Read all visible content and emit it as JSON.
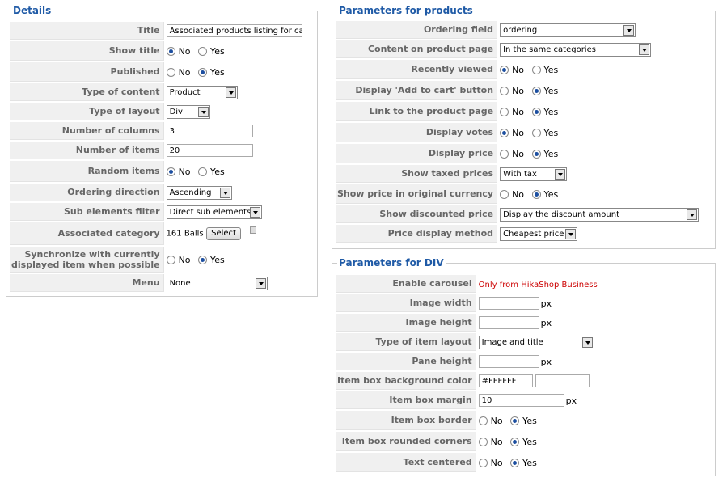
{
  "details": {
    "legend": "Details",
    "title": {
      "label": "Title",
      "value": "Associated products listing for categ"
    },
    "show_title": {
      "label": "Show title",
      "no": "No",
      "yes": "Yes"
    },
    "published": {
      "label": "Published",
      "no": "No",
      "yes": "Yes"
    },
    "type_of_content": {
      "label": "Type of content",
      "value": "Product"
    },
    "type_of_layout": {
      "label": "Type of layout",
      "value": "Div"
    },
    "number_of_columns": {
      "label": "Number of columns",
      "value": "3"
    },
    "number_of_items": {
      "label": "Number of items",
      "value": "20"
    },
    "random_items": {
      "label": "Random items",
      "no": "No",
      "yes": "Yes"
    },
    "ordering_direction": {
      "label": "Ordering direction",
      "value": "Ascending"
    },
    "sub_elements_filter": {
      "label": "Sub elements filter",
      "value": "Direct sub elements"
    },
    "associated_category": {
      "label": "Associated category",
      "value": "161 Balls",
      "button": "Select"
    },
    "synchronize": {
      "label_line1": "Synchronize with currently",
      "label_line2": "displayed item when possible",
      "no": "No",
      "yes": "Yes"
    },
    "menu": {
      "label": "Menu",
      "value": "None"
    }
  },
  "products": {
    "legend": "Parameters for products",
    "ordering_field": {
      "label": "Ordering field",
      "value": "ordering"
    },
    "content_on_product_page": {
      "label": "Content on product page",
      "value": "In the same categories"
    },
    "recently_viewed": {
      "label": "Recently viewed",
      "no": "No",
      "yes": "Yes"
    },
    "add_to_cart": {
      "label": "Display 'Add to cart' button",
      "no": "No",
      "yes": "Yes"
    },
    "link_to_product_page": {
      "label": "Link to the product page",
      "no": "No",
      "yes": "Yes"
    },
    "display_votes": {
      "label": "Display votes",
      "no": "No",
      "yes": "Yes"
    },
    "display_price": {
      "label": "Display price",
      "no": "No",
      "yes": "Yes"
    },
    "show_taxed_prices": {
      "label": "Show taxed prices",
      "value": "With tax"
    },
    "original_currency": {
      "label": "Show price in original currency",
      "no": "No",
      "yes": "Yes"
    },
    "show_discounted_price": {
      "label": "Show discounted price",
      "value": "Display the discount amount"
    },
    "price_display_method": {
      "label": "Price display method",
      "value": "Cheapest price"
    }
  },
  "div": {
    "legend": "Parameters for DIV",
    "enable_carousel": {
      "label": "Enable carousel",
      "value": "Only from HikaShop Business"
    },
    "image_width": {
      "label": "Image width",
      "value": "",
      "unit": "px"
    },
    "image_height": {
      "label": "Image height",
      "value": "",
      "unit": "px"
    },
    "item_layout": {
      "label": "Type of item layout",
      "value": "Image and title"
    },
    "pane_height": {
      "label": "Pane height",
      "value": "",
      "unit": "px"
    },
    "bg_color": {
      "label": "Item box background color",
      "value": "#FFFFFF",
      "value2": ""
    },
    "box_margin": {
      "label": "Item box margin",
      "value": "10",
      "unit": "px"
    },
    "box_border": {
      "label": "Item box border",
      "no": "No",
      "yes": "Yes"
    },
    "rounded_corners": {
      "label": "Item box rounded corners",
      "no": "No",
      "yes": "Yes"
    },
    "text_centered": {
      "label": "Text centered",
      "no": "No",
      "yes": "Yes"
    }
  },
  "colors": {
    "legend": "#1f5aa6",
    "radio_selected": "#1d4fa0",
    "carousel_note": "#cc0000"
  }
}
